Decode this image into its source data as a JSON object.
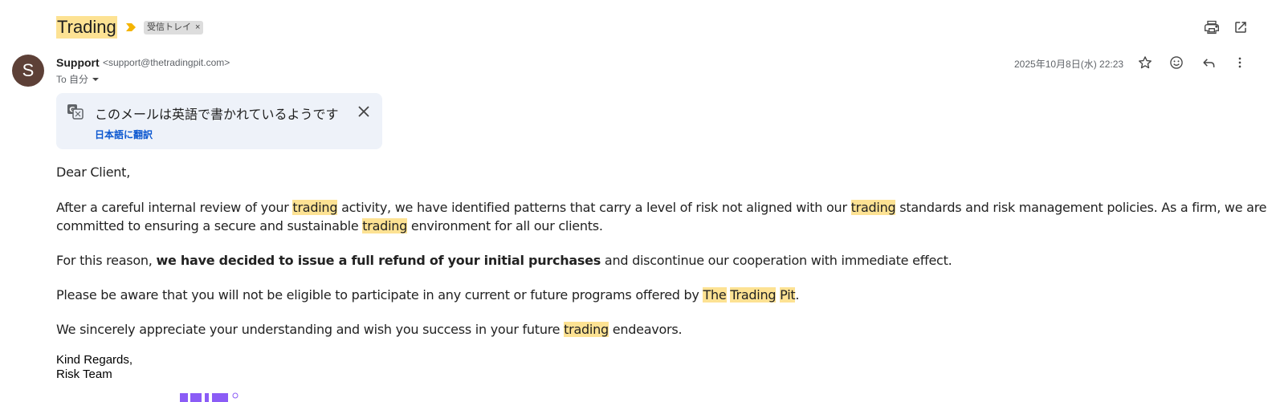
{
  "email": {
    "subject": "Trading",
    "label": "受信トレイ",
    "sender_initial": "S",
    "sender_name": "Support",
    "sender_email": "<support@thetradingpit.com>",
    "to": "To 自分",
    "date": "2025年10月8日(水) 22:23"
  },
  "translate": {
    "message": "このメールは英語で書かれているようです",
    "link": "日本語に翻訳"
  },
  "body": {
    "greeting": "Dear Client,",
    "p1": [
      "After a careful internal review of your ",
      "trading",
      " activity, we have identified patterns that carry a level of risk not aligned with our ",
      "trading",
      " standards and risk management policies. As a firm, we are"
    ],
    "p1b": [
      "committed to ensuring a secure and sustainable ",
      "trading",
      " environment for all our clients."
    ],
    "p2": [
      "For this reason, ",
      "we have decided to issue a full refund of your initial purchases",
      " and discontinue our cooperation with immediate effect."
    ],
    "p3": [
      "Please be aware that you will not be eligible to participate in any current or future programs offered by ",
      "The",
      " ",
      "Trading",
      " ",
      "Pit",
      "."
    ],
    "p4": [
      "We sincerely appreciate your understanding and wish you success in your future ",
      "trading",
      " endeavors."
    ],
    "sig1": "Kind Regards,",
    "sig2": "Risk Team"
  },
  "icons": {
    "print": "print-icon",
    "open": "open-in-new-icon",
    "star": "star-icon",
    "emoji": "emoji-icon",
    "reply": "reply-icon",
    "more": "more-vert-icon"
  },
  "colors": {
    "highlight": "#fde293",
    "avatar": "#5d4037",
    "link": "#0b57d0",
    "translate_bg": "#eef2f9",
    "logo": "#8b5cf6"
  }
}
